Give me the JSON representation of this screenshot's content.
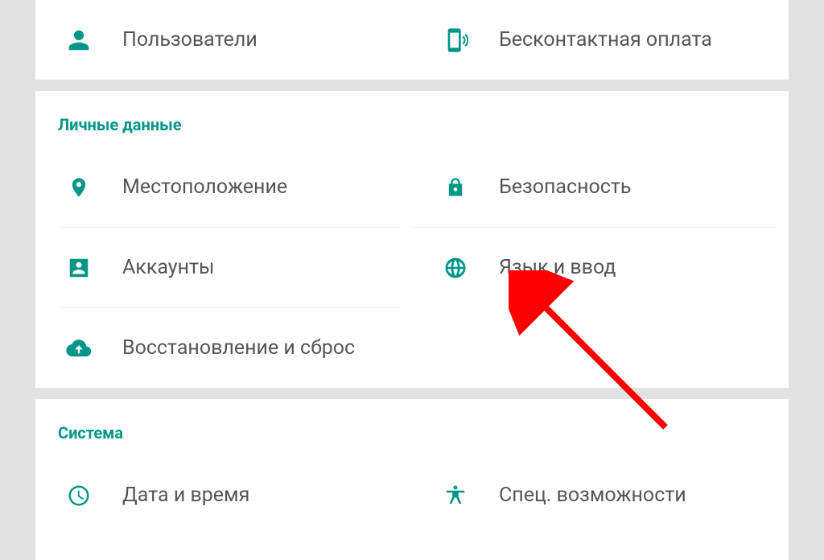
{
  "colors": {
    "accent": "#009688",
    "text": "#555555",
    "arrow": "#ff0000"
  },
  "top": {
    "left": {
      "label": "Пользователи"
    },
    "right": {
      "label": "Бесконтактная оплата"
    }
  },
  "section_personal": {
    "title": "Личные данные",
    "location": {
      "label": "Местоположение"
    },
    "security": {
      "label": "Безопасность"
    },
    "accounts": {
      "label": "Аккаунты"
    },
    "language": {
      "label": "Язык и ввод"
    },
    "backup": {
      "label": "Восстановление и сброс"
    }
  },
  "section_system": {
    "title": "Система",
    "datetime": {
      "label": "Дата и время"
    },
    "accessibility": {
      "label": "Спец. возможности"
    }
  }
}
